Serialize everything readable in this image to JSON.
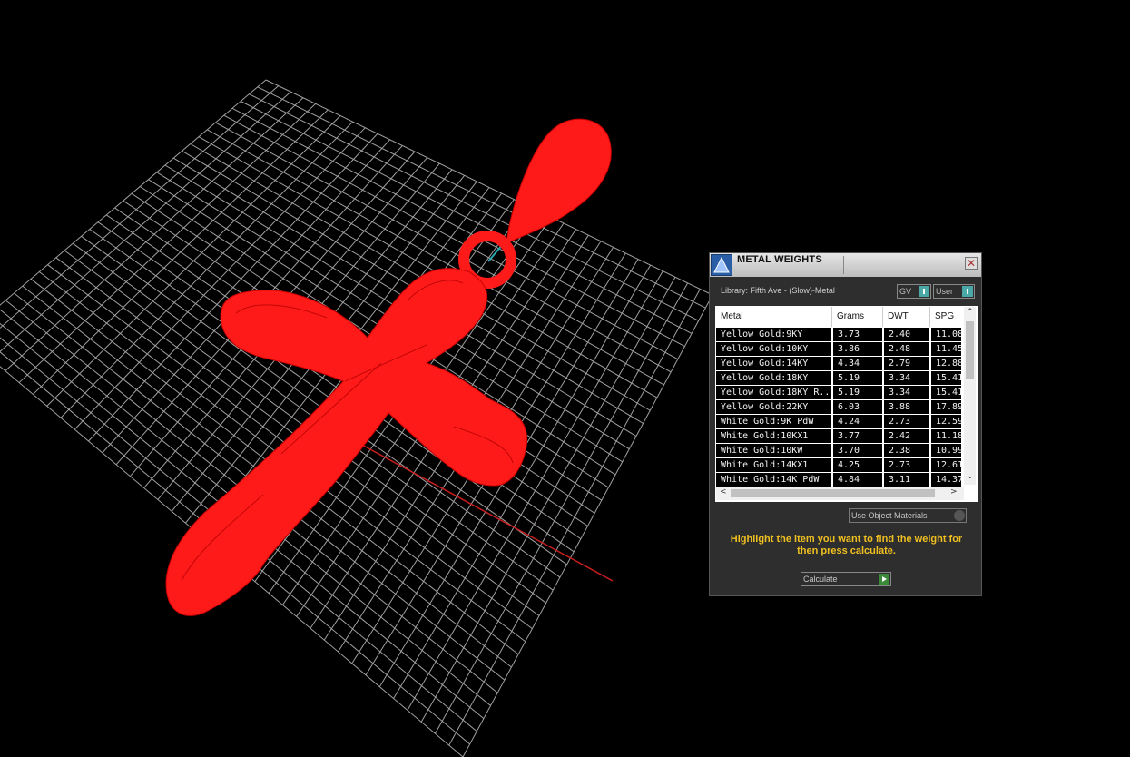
{
  "viewport": {
    "grid_color": "#bdbdbd",
    "model_color": "#ff1a1a",
    "axis_red": "#c81e1e",
    "axis_teal": "#2aa7b0"
  },
  "panel": {
    "title": "METAL WEIGHTS",
    "close_glyph": "✕",
    "library_label": "Library: Fifth Ave - (Slow)-Metal",
    "toggle_gv": "GV",
    "toggle_user": "User",
    "columns": [
      "Metal",
      "Grams",
      "DWT",
      "SPG"
    ],
    "rows": [
      [
        "Yellow Gold:9KY",
        "3.73",
        "2.40",
        "11.08"
      ],
      [
        "Yellow Gold:10KY",
        "3.86",
        "2.48",
        "11.45"
      ],
      [
        "Yellow Gold:14KY",
        "4.34",
        "2.79",
        "12.88"
      ],
      [
        "Yellow Gold:18KY",
        "5.19",
        "3.34",
        "15.41"
      ],
      [
        "Yellow Gold:18KY R...",
        "5.19",
        "3.34",
        "15.41"
      ],
      [
        "Yellow Gold:22KY",
        "6.03",
        "3.88",
        "17.89"
      ],
      [
        "White Gold:9K PdW",
        "4.24",
        "2.73",
        "12.59"
      ],
      [
        "White Gold:10KX1",
        "3.77",
        "2.42",
        "11.18"
      ],
      [
        "White Gold:10KW",
        "3.70",
        "2.38",
        "10.99"
      ],
      [
        "White Gold:14KX1",
        "4.25",
        "2.73",
        "12.61"
      ],
      [
        "White Gold:14K PdW",
        "4.84",
        "3.11",
        "14.37"
      ]
    ],
    "use_object_materials": "Use Object Materials",
    "hint": "Highlight the item you want to find the weight for then press calculate.",
    "calculate_label": "Calculate",
    "scroll_up": "⌃",
    "scroll_down": "⌄",
    "scroll_left": "<",
    "scroll_right": ">"
  }
}
